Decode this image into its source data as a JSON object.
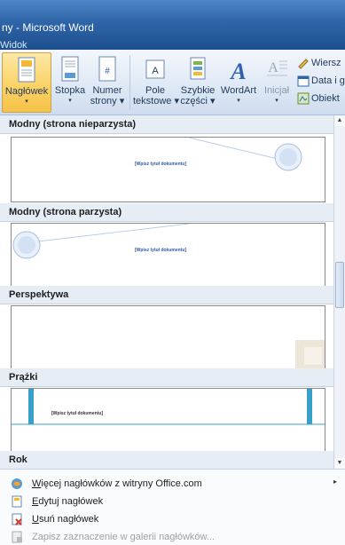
{
  "window": {
    "title": "ny - Microsoft Word",
    "tab": "Widok"
  },
  "ribbon": {
    "buttons": [
      {
        "label": "Nagłówek",
        "arrow": "▾"
      },
      {
        "label": "Stopka",
        "arrow": "▾"
      },
      {
        "label": "Numer",
        "label2": "strony",
        "arrow": "▾"
      },
      {
        "label": "Pole",
        "label2": "tekstowe",
        "arrow": "▾"
      },
      {
        "label": "Szybkie",
        "label2": "części",
        "arrow": "▾"
      },
      {
        "label": "WordArt",
        "arrow": "▾"
      },
      {
        "label": "Inicjał",
        "arrow": "▾"
      }
    ],
    "small": [
      {
        "label": "Wiersz"
      },
      {
        "label": "Data i g"
      },
      {
        "label": "Obiekt"
      }
    ]
  },
  "gallery": {
    "placeholder": "[Wpisz tytuł dokumentu]",
    "sections": [
      {
        "title": "Modny (strona nieparzysta)"
      },
      {
        "title": "Modny (strona parzysta)"
      },
      {
        "title": "Perspektywa"
      },
      {
        "title": "Prążki"
      },
      {
        "title": "Rok"
      }
    ]
  },
  "menu": {
    "items": [
      {
        "label": "Więcej nagłówków z witryny Office.com",
        "accel": "W",
        "rest": "ięcej nagłówków z witryny Office.com",
        "submenu": "▸"
      },
      {
        "label": "Edytuj nagłówek",
        "accel": "E",
        "rest": "dytuj nagłówek"
      },
      {
        "label": "Usuń nagłówek",
        "accel": "U",
        "rest": "suń nagłówek"
      },
      {
        "label": "Zapisz zaznaczenie w galerii nagłówków...",
        "accel": "",
        "rest": "Zapisz zaznaczenie w galerii nagłówków..."
      }
    ]
  },
  "colors": {
    "accent": "#2e65a8",
    "highlight": "#fbd56c",
    "stripe": "#36a0c8"
  }
}
